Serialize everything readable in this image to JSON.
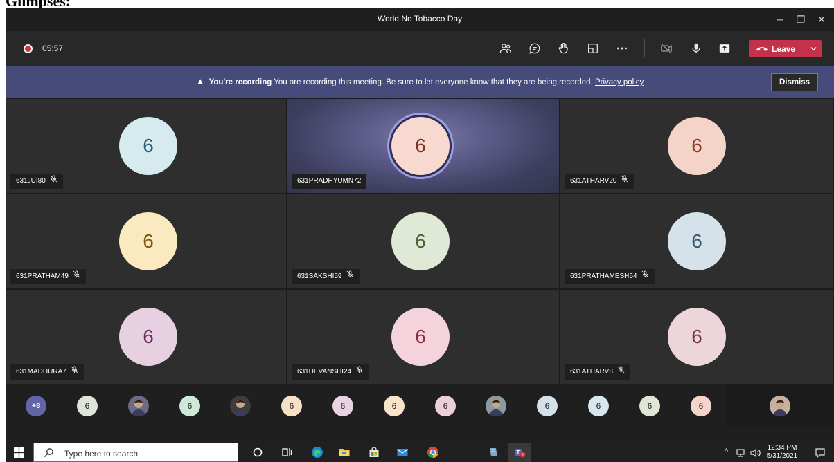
{
  "document": {
    "heading": "Glimpses:"
  },
  "window": {
    "title": "World No Tobacco Day",
    "controls": {
      "minimize": "─",
      "maximize": "❐",
      "close": "✕"
    }
  },
  "meeting_controls": {
    "timer": "05:57",
    "leave_label": "Leave",
    "icons": [
      "people-icon",
      "chat-icon",
      "raise-hand-icon",
      "rooms-icon",
      "more-icon",
      "camera-off-icon",
      "microphone-icon",
      "share-icon"
    ]
  },
  "banner": {
    "strong": "You're recording",
    "message": "You are recording this meeting. Be sure to let everyone know that they are being recorded.",
    "link": "Privacy policy",
    "dismiss": "Dismiss"
  },
  "participants": [
    {
      "name": "631JUI80",
      "initial": "6",
      "muted": true,
      "speaking": false,
      "avatar_bg": "#d6ebf0",
      "avatar_fg": "#2f5c6e"
    },
    {
      "name": "631PRADHYUMN72",
      "initial": "6",
      "muted": false,
      "speaking": true,
      "avatar_bg": "#f8d9cf",
      "avatar_fg": "#7a3324"
    },
    {
      "name": "631ATHARV20",
      "initial": "6",
      "muted": true,
      "speaking": false,
      "avatar_bg": "#f4d3c8",
      "avatar_fg": "#8a3a24"
    },
    {
      "name": "631PRATHAM49",
      "initial": "6",
      "muted": true,
      "speaking": false,
      "avatar_bg": "#fbe9c0",
      "avatar_fg": "#7a5a12"
    },
    {
      "name": "631SAKSHI59",
      "initial": "6",
      "muted": true,
      "speaking": false,
      "avatar_bg": "#e0e8d6",
      "avatar_fg": "#4f6237"
    },
    {
      "name": "631PRATHAMESH54",
      "initial": "6",
      "muted": true,
      "speaking": false,
      "avatar_bg": "#d5e2ea",
      "avatar_fg": "#345870"
    },
    {
      "name": "631MADHURA7",
      "initial": "6",
      "muted": true,
      "speaking": false,
      "avatar_bg": "#e7d1e1",
      "avatar_fg": "#6c3160"
    },
    {
      "name": "631DEVANSHI24",
      "initial": "6",
      "muted": true,
      "speaking": false,
      "avatar_bg": "#f4d3dc",
      "avatar_fg": "#8a2e46"
    },
    {
      "name": "631ATHARV8",
      "initial": "6",
      "muted": true,
      "speaking": false,
      "avatar_bg": "#ecd6d9",
      "avatar_fg": "#7a3540"
    }
  ],
  "strip": {
    "more": "+8",
    "items": [
      {
        "kind": "initial",
        "text": "6",
        "bg": "#dde4d8"
      },
      {
        "kind": "photo",
        "bg": "#6a6a8a"
      },
      {
        "kind": "initial",
        "text": "6",
        "bg": "#cfe8d8"
      },
      {
        "kind": "photo",
        "bg": "#3d3d3d"
      },
      {
        "kind": "initial",
        "text": "6",
        "bg": "#f8e0c6"
      },
      {
        "kind": "initial",
        "text": "6",
        "bg": "#e8d2e4"
      },
      {
        "kind": "initial",
        "text": "6",
        "bg": "#f8e4c8"
      },
      {
        "kind": "initial",
        "text": "6",
        "bg": "#ecd0d8"
      },
      {
        "kind": "photo",
        "bg": "#8a9aa0"
      },
      {
        "kind": "initial",
        "text": "6",
        "bg": "#d4e0ea"
      },
      {
        "kind": "initial",
        "text": "6",
        "bg": "#d8e6ee"
      },
      {
        "kind": "initial",
        "text": "6",
        "bg": "#dfe6d6"
      },
      {
        "kind": "initial",
        "text": "6",
        "bg": "#f6d4cc"
      }
    ],
    "pinned": {
      "kind": "photo",
      "bg": "#c8b0a0"
    }
  },
  "taskbar": {
    "search_placeholder": "Type here to search",
    "time": "12:34 PM",
    "date": "5/31/2021",
    "teams_badge": "2",
    "tray_chevron": "^"
  }
}
